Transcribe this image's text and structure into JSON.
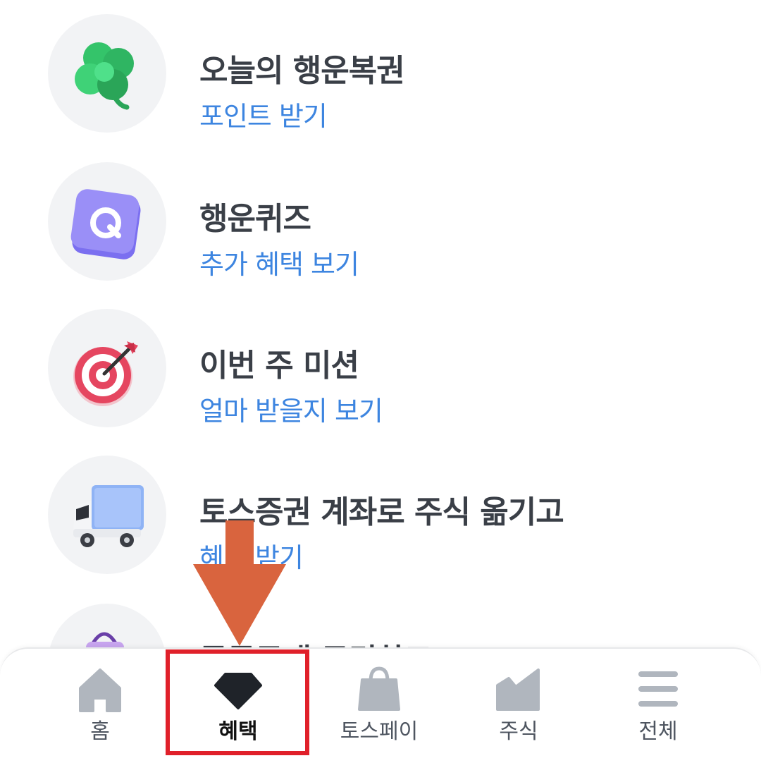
{
  "benefits": {
    "items": [
      {
        "title": "오늘의 행운복권",
        "action": "포인트 받기",
        "icon": "clover-icon"
      },
      {
        "title": "행운퀴즈",
        "action": "추가 혜택 보기",
        "icon": "quiz-q-icon"
      },
      {
        "title": "이번 주 미션",
        "action": "얼마 받을지 보기",
        "icon": "dart-target-icon"
      },
      {
        "title": "토스증권 계좌로 주식 옮기고",
        "action": "혜택 받기",
        "icon": "truck-icon"
      },
      {
        "title": "공동구매 구경하고",
        "icon": "shopping-bag-icon"
      }
    ]
  },
  "tabbar": {
    "tabs": [
      {
        "label": "홈",
        "icon": "home-icon"
      },
      {
        "label": "혜택",
        "icon": "gem-icon",
        "active": true
      },
      {
        "label": "토스페이",
        "icon": "shopping-bag-icon"
      },
      {
        "label": "주식",
        "icon": "stock-chart-icon"
      },
      {
        "label": "전체",
        "icon": "menu-icon"
      }
    ]
  },
  "colors": {
    "accent_blue": "#3d85e0",
    "title_gray": "#3a3f47",
    "icon_gray": "#b0b6be",
    "highlight_red": "#e0202a",
    "arrow_orange": "#d9643e"
  }
}
